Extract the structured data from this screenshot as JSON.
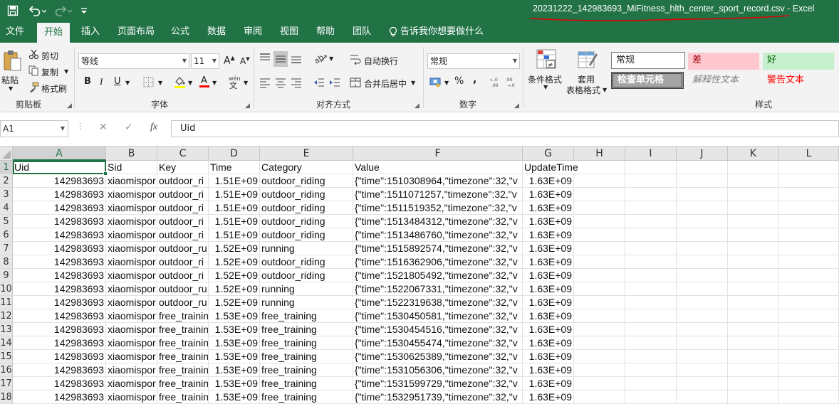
{
  "window": {
    "doc_title": "20231222_142983693_MiFitness_hlth_center_sport_record.csv  -  Excel"
  },
  "tabs": [
    "文件",
    "开始",
    "插入",
    "页面布局",
    "公式",
    "数据",
    "审阅",
    "视图",
    "帮助",
    "团队"
  ],
  "tell_me": "告诉我你想要做什么",
  "ribbon": {
    "clipboard": {
      "paste": "粘贴",
      "cut": "剪切",
      "copy": "复制",
      "format_painter": "格式刷",
      "label": "剪贴板"
    },
    "font": {
      "name": "等线",
      "size": "11",
      "label": "字体",
      "bold": "B",
      "italic": "I",
      "underline": "U",
      "grow": "A",
      "shrink": "A"
    },
    "alignment": {
      "wrap": "自动换行",
      "merge": "合并后居中",
      "label": "对齐方式"
    },
    "number": {
      "format": "常规",
      "percent": "%",
      "comma": ",",
      "label": "数字"
    },
    "styles": {
      "conditional": "条件格式",
      "table_line1": "套用",
      "table_line2": "表格格式",
      "normal": "常规",
      "bad": "差",
      "good": "好",
      "check": "检查单元格",
      "explanatory": "解释性文本",
      "warning": "警告文本",
      "label": "样式"
    }
  },
  "formula_bar": {
    "name_box": "A1",
    "fx": "fx",
    "value": "Uid"
  },
  "grid": {
    "columns": [
      "A",
      "B",
      "C",
      "D",
      "E",
      "F",
      "G",
      "H",
      "I",
      "J",
      "K",
      "L"
    ],
    "header_row": [
      "Uid",
      "Sid",
      "Key",
      "Time",
      "Category",
      "Value",
      "UpdateTime"
    ],
    "rows": [
      {
        "n": "1"
      },
      {
        "n": "2",
        "a": "142983693",
        "b": "xiaomispor",
        "c": "outdoor_ri",
        "d": "1.51E+09",
        "e": "outdoor_riding",
        "f": "{\"time\":1510308964,\"timezone\":32,\"v",
        "g": "1.63E+09"
      },
      {
        "n": "3",
        "a": "142983693",
        "b": "xiaomispor",
        "c": "outdoor_ri",
        "d": "1.51E+09",
        "e": "outdoor_riding",
        "f": "{\"time\":1511071257,\"timezone\":32,\"v",
        "g": "1.63E+09"
      },
      {
        "n": "4",
        "a": "142983693",
        "b": "xiaomispor",
        "c": "outdoor_ri",
        "d": "1.51E+09",
        "e": "outdoor_riding",
        "f": "{\"time\":1511519352,\"timezone\":32,\"v",
        "g": "1.63E+09"
      },
      {
        "n": "5",
        "a": "142983693",
        "b": "xiaomispor",
        "c": "outdoor_ri",
        "d": "1.51E+09",
        "e": "outdoor_riding",
        "f": "{\"time\":1513484312,\"timezone\":32,\"v",
        "g": "1.63E+09"
      },
      {
        "n": "6",
        "a": "142983693",
        "b": "xiaomispor",
        "c": "outdoor_ri",
        "d": "1.51E+09",
        "e": "outdoor_riding",
        "f": "{\"time\":1513486760,\"timezone\":32,\"v",
        "g": "1.63E+09"
      },
      {
        "n": "7",
        "a": "142983693",
        "b": "xiaomispor",
        "c": "outdoor_ru",
        "d": "1.52E+09",
        "e": "running",
        "f": "{\"time\":1515892574,\"timezone\":32,\"v",
        "g": "1.63E+09"
      },
      {
        "n": "8",
        "a": "142983693",
        "b": "xiaomispor",
        "c": "outdoor_ri",
        "d": "1.52E+09",
        "e": "outdoor_riding",
        "f": "{\"time\":1516362906,\"timezone\":32,\"v",
        "g": "1.63E+09"
      },
      {
        "n": "9",
        "a": "142983693",
        "b": "xiaomispor",
        "c": "outdoor_ri",
        "d": "1.52E+09",
        "e": "outdoor_riding",
        "f": "{\"time\":1521805492,\"timezone\":32,\"v",
        "g": "1.63E+09"
      },
      {
        "n": "10",
        "a": "142983693",
        "b": "xiaomispor",
        "c": "outdoor_ru",
        "d": "1.52E+09",
        "e": "running",
        "f": "{\"time\":1522067331,\"timezone\":32,\"v",
        "g": "1.63E+09"
      },
      {
        "n": "11",
        "a": "142983693",
        "b": "xiaomispor",
        "c": "outdoor_ru",
        "d": "1.52E+09",
        "e": "running",
        "f": "{\"time\":1522319638,\"timezone\":32,\"v",
        "g": "1.63E+09"
      },
      {
        "n": "12",
        "a": "142983693",
        "b": "xiaomispor",
        "c": "free_trainin",
        "d": "1.53E+09",
        "e": "free_training",
        "f": "{\"time\":1530450581,\"timezone\":32,\"v",
        "g": "1.63E+09"
      },
      {
        "n": "13",
        "a": "142983693",
        "b": "xiaomispor",
        "c": "free_trainin",
        "d": "1.53E+09",
        "e": "free_training",
        "f": "{\"time\":1530454516,\"timezone\":32,\"v",
        "g": "1.63E+09"
      },
      {
        "n": "14",
        "a": "142983693",
        "b": "xiaomispor",
        "c": "free_trainin",
        "d": "1.53E+09",
        "e": "free_training",
        "f": "{\"time\":1530455474,\"timezone\":32,\"v",
        "g": "1.63E+09"
      },
      {
        "n": "15",
        "a": "142983693",
        "b": "xiaomispor",
        "c": "free_trainin",
        "d": "1.53E+09",
        "e": "free_training",
        "f": "{\"time\":1530625389,\"timezone\":32,\"v",
        "g": "1.63E+09"
      },
      {
        "n": "16",
        "a": "142983693",
        "b": "xiaomispor",
        "c": "free_trainin",
        "d": "1.53E+09",
        "e": "free_training",
        "f": "{\"time\":1531056306,\"timezone\":32,\"v",
        "g": "1.63E+09"
      },
      {
        "n": "17",
        "a": "142983693",
        "b": "xiaomispor",
        "c": "free_trainin",
        "d": "1.53E+09",
        "e": "free_training",
        "f": "{\"time\":1531599729,\"timezone\":32,\"v",
        "g": "1.63E+09"
      },
      {
        "n": "18",
        "a": "142983693",
        "b": "xiaomispor",
        "c": "free_trainin",
        "d": "1.53E+09",
        "e": "free_training",
        "f": "{\"time\":1532951739,\"timezone\":32,\"v",
        "g": "1.63E+09"
      }
    ]
  },
  "colors": {
    "accent": "#217346",
    "bad_bg": "#ffc7ce",
    "bad_fg": "#9c0006",
    "good_bg": "#c6efce",
    "good_fg": "#006100",
    "check_bg": "#a5a5a5",
    "warning_fg": "#ff0000",
    "annotation": "#e00000"
  }
}
